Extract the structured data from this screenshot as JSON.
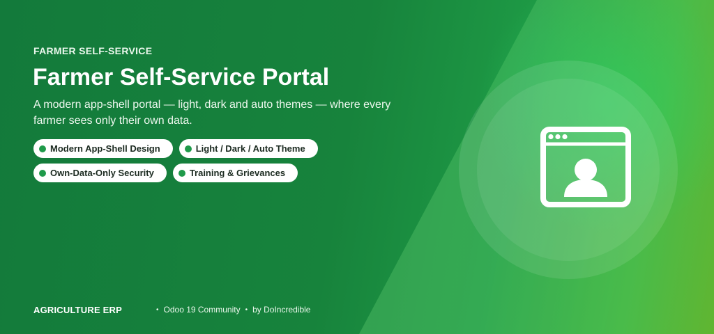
{
  "banner": {
    "eyebrow": "FARMER SELF-SERVICE",
    "title": "Farmer Self-Service Portal",
    "subtitle": "A modern app-shell portal — light, dark and auto themes — where every farmer sees only their own data.",
    "features": [
      {
        "label": "Modern App-Shell Design"
      },
      {
        "label": "Light / Dark / Auto Theme"
      },
      {
        "label": "Own-Data-Only Security"
      },
      {
        "label": "Training & Grievances"
      }
    ],
    "icon": "portal-window-user-icon"
  },
  "footer": {
    "brand": "AGRICULTURE ERP",
    "bullet": "•",
    "platform": "Odoo 19 Community",
    "separator": "•",
    "author": "by DoIncredible"
  },
  "colors": {
    "gradient_start": "#137a3b",
    "gradient_end": "#6aad14",
    "accent_dot": "#1f9a4a",
    "pill_bg": "#ffffff",
    "pill_text": "#1b2a20"
  }
}
